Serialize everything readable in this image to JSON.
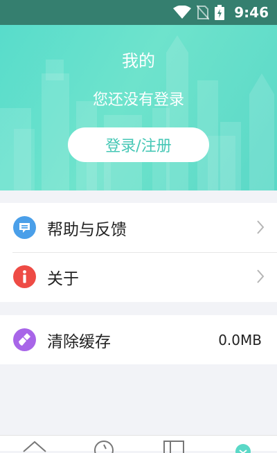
{
  "status_bar": {
    "time": "9:46",
    "icons": [
      "wifi-icon",
      "no-sim-icon",
      "battery-charging-icon"
    ]
  },
  "header": {
    "title": "我的",
    "login_hint": "您还没有登录",
    "login_button": "登录/注册"
  },
  "menu": {
    "help_feedback": {
      "label": "帮助与反馈",
      "icon": "message-icon"
    },
    "about": {
      "label": "关于",
      "icon": "info-icon"
    },
    "clear_cache": {
      "label": "清除缓存",
      "value": "0.0MB",
      "icon": "broom-icon"
    }
  },
  "bottom_nav": {
    "items": [
      "home-icon",
      "compass-icon",
      "book-icon",
      "profile-icon"
    ],
    "active": "profile-icon"
  },
  "colors": {
    "accent": "#5ad8c7",
    "status_bar": "#357f6f",
    "help_icon": "#4a9fe9",
    "about_icon": "#ee4b45",
    "cache_icon": "#a865e8"
  }
}
